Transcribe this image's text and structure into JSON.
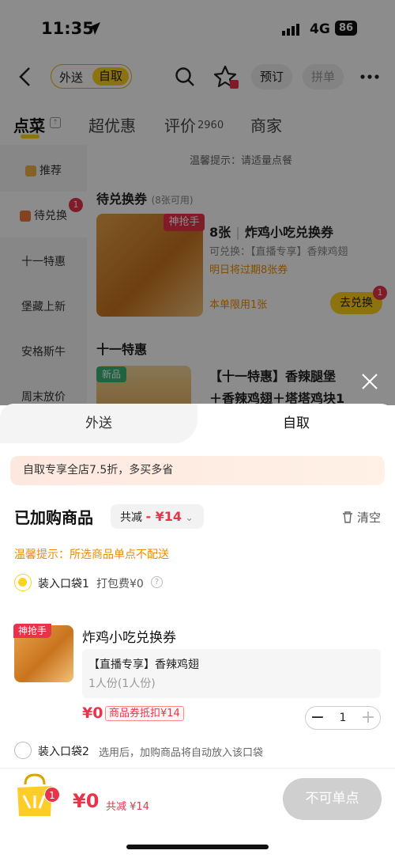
{
  "status": {
    "time": "11:35",
    "network": "4G",
    "battery": "86"
  },
  "header": {
    "mode_delivery": "外送",
    "mode_pickup": "自取",
    "reserve": "预订",
    "group": "拼单"
  },
  "tabs": {
    "order": "点菜",
    "deals": "超优惠",
    "reviews": "评价",
    "reviews_count": "2960",
    "merchant": "商家"
  },
  "sidebar": {
    "items": [
      {
        "label": "推荐"
      },
      {
        "label": "待兑换",
        "count": "1"
      },
      {
        "label": "十一特惠"
      },
      {
        "label": "堡藏上新"
      },
      {
        "label": "安格斯牛"
      },
      {
        "label": "周末放价"
      }
    ]
  },
  "menu": {
    "hint": "温馨提示：请适量点餐",
    "section1_title": "待兑换券",
    "section1_sub": "(8张可用)",
    "card_badge": "神抢手",
    "card_title_qty": "8张",
    "card_title": "炸鸡小吃兑换券",
    "card_redeem": "可兑换：【直播专享】香辣鸡翅",
    "card_expire": "明日将过期8张券",
    "card_limit": "本单限用1张",
    "card_button": "去兑换",
    "card_button_count": "1",
    "section2_title": "十一特惠",
    "new_badge": "新品",
    "card2_title_line1": "【十一特惠】香辣腿堡",
    "card2_title_line2": "＋香辣鸡翅＋塔塔鸡块1"
  },
  "sheet": {
    "tab_delivery": "外送",
    "tab_pickup": "自取",
    "promo": "自取专享全店7.5折，多买多省",
    "added_title": "已加购商品",
    "discount_label": "共减",
    "discount_value": "- ¥14",
    "clear": "清空",
    "warning": "温馨提示：所选商品单点不配送",
    "bag1_label": "装入口袋1",
    "bag1_fee": "打包费¥0",
    "item": {
      "badge": "神抢手",
      "name": "炸鸡小吃兑换券",
      "desc": "【直播专享】香辣鸡翅",
      "portion": "1人份(1人份)",
      "price": "¥0",
      "coupon": "商品券抵扣¥14",
      "qty": "1"
    },
    "bag2_label": "装入口袋2",
    "bag2_tip": "选用后，加购商品将自动放入该口袋"
  },
  "footer": {
    "cart_count": "1",
    "total": "¥0",
    "total_sub": "共减 ¥14",
    "checkout": "不可单点"
  },
  "colors": {
    "accent_yellow": "#ffd21e",
    "price_red": "#e8344a",
    "warning_orange": "#f08a00"
  }
}
